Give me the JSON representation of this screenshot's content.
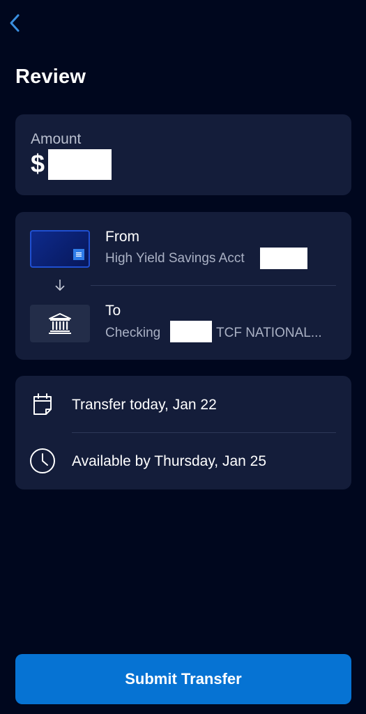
{
  "header": {
    "back_icon": "chevron-left-icon",
    "title": "Review"
  },
  "amount": {
    "label": "Amount",
    "currency_symbol": "$"
  },
  "accounts": {
    "from_label": "From",
    "from_account": "High Yield Savings Acct",
    "to_label": "To",
    "to_account_type": "Checking",
    "to_bank": "TCF NATIONAL..."
  },
  "schedule": {
    "transfer_date": "Transfer today, Jan 22",
    "available_date": "Available by Thursday, Jan 25",
    "transfer_icon": "calendar-icon",
    "available_icon": "clock-icon"
  },
  "actions": {
    "submit_label": "Submit Transfer"
  },
  "colors": {
    "background": "#00071e",
    "card": "#141d3a",
    "accent": "#0673d3",
    "back_chevron": "#3a8fe0"
  }
}
